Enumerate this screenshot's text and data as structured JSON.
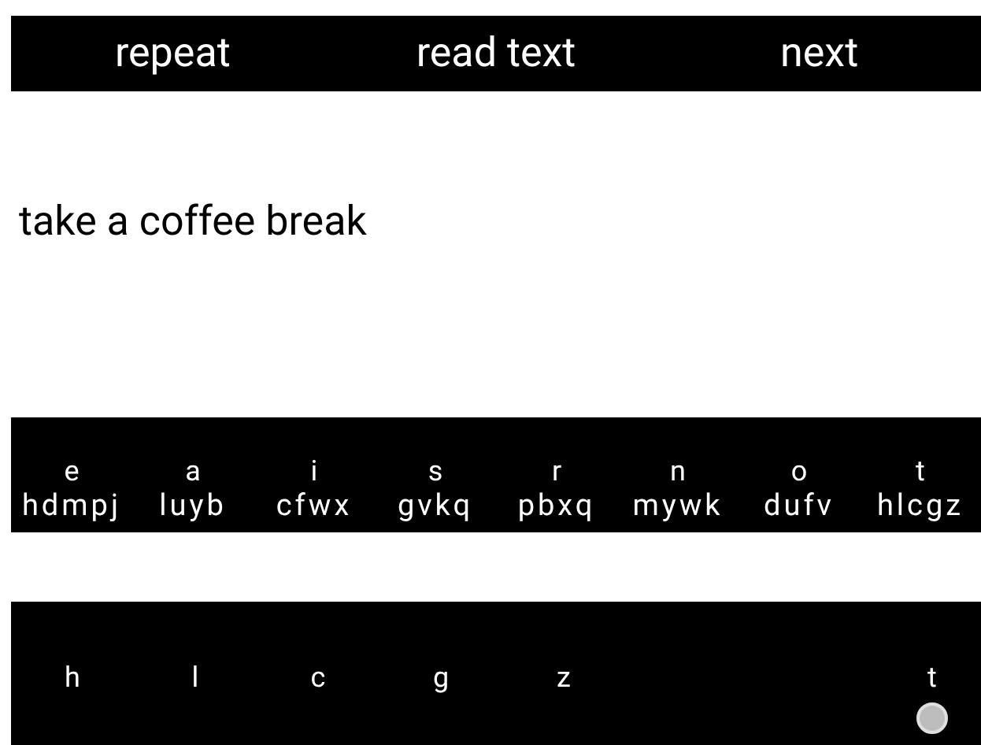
{
  "top_bar": {
    "buttons": [
      "repeat",
      "read text",
      "next"
    ]
  },
  "prompt": "take a coffee break",
  "letter_row": [
    {
      "letter": "e",
      "candidates": "hdmpj"
    },
    {
      "letter": "a",
      "candidates": "luyb"
    },
    {
      "letter": "i",
      "candidates": "cfwx"
    },
    {
      "letter": "s",
      "candidates": "gvkq"
    },
    {
      "letter": "r",
      "candidates": "pbxq"
    },
    {
      "letter": "n",
      "candidates": "mywk"
    },
    {
      "letter": "o",
      "candidates": "dufv"
    },
    {
      "letter": "t",
      "candidates": "hlcgz"
    }
  ],
  "choice_row": [
    {
      "kind": "key",
      "label": "h",
      "pressed": false
    },
    {
      "kind": "key",
      "label": "l",
      "pressed": false
    },
    {
      "kind": "key",
      "label": "c",
      "pressed": false
    },
    {
      "kind": "key",
      "label": "g",
      "pressed": false
    },
    {
      "kind": "key",
      "label": "z",
      "pressed": false
    },
    {
      "kind": "empty"
    },
    {
      "kind": "empty"
    },
    {
      "kind": "key",
      "label": "t",
      "pressed": true
    }
  ]
}
